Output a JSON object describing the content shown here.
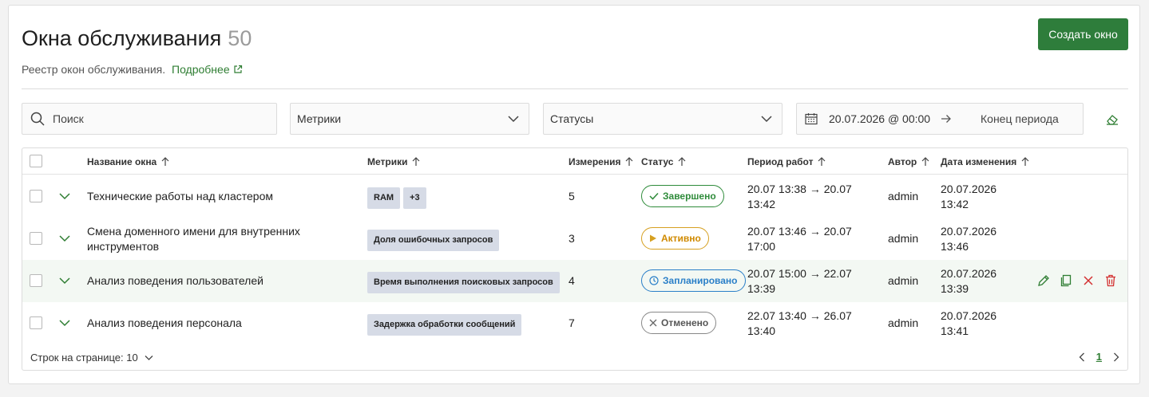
{
  "header": {
    "title": "Окна обслуживания",
    "count": "50",
    "subtitle": "Реестр окон обслуживания.",
    "more_link": "Подробнее",
    "create_button": "Создать окно"
  },
  "filters": {
    "search_placeholder": "Поиск",
    "metrics_placeholder": "Метрики",
    "statuses_placeholder": "Статусы",
    "period_start": "20.07.2026 @ 00:00:00",
    "period_end_placeholder": "Конец периода"
  },
  "table": {
    "columns": {
      "name": "Название окна",
      "metrics": "Метрики",
      "dimensions": "Измерения",
      "status": "Статус",
      "period": "Период работ",
      "author": "Автор",
      "changed": "Дата изменения"
    },
    "rows": [
      {
        "name": "Технические работы над кластером",
        "tags": [
          "RAM",
          "+3"
        ],
        "dimensions": "5",
        "status": "Завершено",
        "status_kind": "done",
        "period_line1": "20.07 13:38 → 20.07",
        "period_line2": "13:42",
        "author": "admin",
        "changed_line1": "20.07.2026",
        "changed_line2": "13:42"
      },
      {
        "name_line1": "Смена доменного имени для внутренних",
        "name_line2": "инструментов",
        "tags": [
          "Доля ошибочных запросов"
        ],
        "dimensions": "3",
        "status": "Активно",
        "status_kind": "active",
        "period_line1": "20.07 13:46 → 20.07",
        "period_line2": "17:00",
        "author": "admin",
        "changed_line1": "20.07.2026",
        "changed_line2": "13:46"
      },
      {
        "name": "Анализ поведения пользователей",
        "tags": [
          "Время выполнения поисковых запросов"
        ],
        "dimensions": "4",
        "status": "Запланировано",
        "status_kind": "planned",
        "period_line1": "20.07 15:00 → 22.07",
        "period_line2": "13:39",
        "author": "admin",
        "changed_line1": "20.07.2026",
        "changed_line2": "13:39"
      },
      {
        "name": "Анализ поведения персонала",
        "tags": [
          "Задержка обработки сообщений"
        ],
        "dimensions": "7",
        "status": "Отменено",
        "status_kind": "cancelled",
        "period_line1": "22.07 13:40 → 26.07",
        "period_line2": "13:40",
        "author": "admin",
        "changed_line1": "20.07.2026",
        "changed_line2": "13:41"
      }
    ]
  },
  "footer": {
    "rows_per_page": "Строк на странице: 10",
    "current_page": "1"
  },
  "colors": {
    "accent": "#2e7d3b",
    "done": "#2e8b3a",
    "active": "#d08a00",
    "planned": "#2a7fc8",
    "cancelled": "#555555",
    "tag_bg": "#d6dbe6",
    "danger": "#d32f2f"
  },
  "icons": {
    "search": "search-icon",
    "chevron": "chevron-down-icon",
    "calendar": "calendar-icon",
    "eraser": "eraser-icon",
    "external": "external-link-icon",
    "edit": "pencil-icon",
    "copy": "copy-icon",
    "cancel": "close-icon",
    "delete": "trash-icon"
  }
}
